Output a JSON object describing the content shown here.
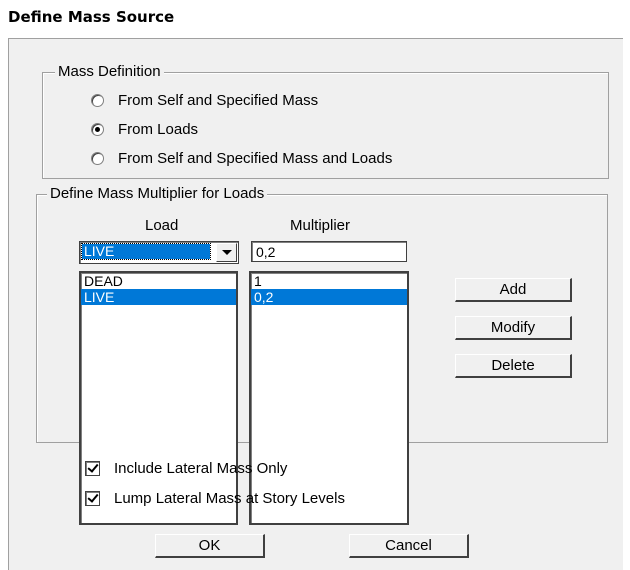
{
  "window": {
    "title": "Define Mass Source"
  },
  "mass_definition": {
    "legend": "Mass Definition",
    "options": [
      {
        "label": "From Self and Specified Mass",
        "checked": false
      },
      {
        "label": "From Loads",
        "checked": true
      },
      {
        "label": "From Self and Specified Mass and Loads",
        "checked": false
      }
    ]
  },
  "multiplier_group": {
    "legend": "Define Mass Multiplier for Loads",
    "load_header": "Load",
    "multiplier_header": "Multiplier",
    "load_select_value": "LIVE",
    "multiplier_input_value": "0,2",
    "load_list": [
      "DEAD",
      "LIVE"
    ],
    "multiplier_list": [
      "1",
      "0,2"
    ],
    "selected_index": 1,
    "add_label": "Add",
    "modify_label": "Modify",
    "delete_label": "Delete"
  },
  "options": {
    "include_lateral": {
      "label": "Include Lateral Mass Only",
      "checked": true
    },
    "lump_lateral": {
      "label": "Lump Lateral Mass at Story Levels",
      "checked": true
    }
  },
  "footer": {
    "ok_label": "OK",
    "cancel_label": "Cancel"
  }
}
